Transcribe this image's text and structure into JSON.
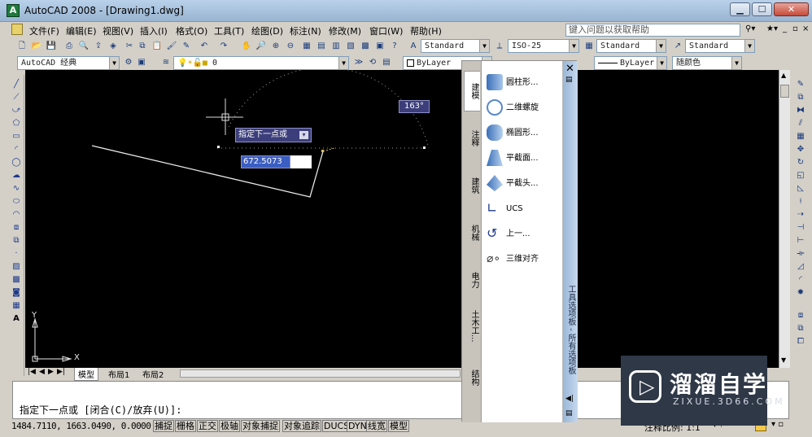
{
  "window": {
    "title": "AutoCAD 2008 - [Drawing1.dwg]",
    "app_icon_label": "A"
  },
  "menubar": {
    "items": [
      "文件(F)",
      "编辑(E)",
      "视图(V)",
      "插入(I)",
      "格式(O)",
      "工具(T)",
      "绘图(D)",
      "标注(N)",
      "修改(M)",
      "窗口(W)",
      "帮助(H)"
    ],
    "help_placeholder": "键入问题以获取帮助"
  },
  "toolbar_styles": {
    "text_style": "Standard",
    "dim_style": "ISO-25",
    "table_style": "Standard",
    "multileader_style": "Standard"
  },
  "toolbar_layers": {
    "workspace": "AutoCAD 经典",
    "layer": "0",
    "color": "ByLayer",
    "linetype": "ByLayer",
    "plotstyle": "随颜色"
  },
  "canvas": {
    "angle_tooltip": "163°",
    "prompt_tooltip": "指定下一点或",
    "length_input": "672.5073",
    "ucs_x": "X",
    "ucs_y": "Y"
  },
  "layout_tabs": [
    "模型",
    "布局1",
    "布局2"
  ],
  "command": {
    "prompt": "指定下一点或 [闭合(C)/放弃(U)]:"
  },
  "statusbar": {
    "coords": "1484.7110, 1663.0490, 0.0000",
    "toggles": [
      "捕捉",
      "栅格",
      "正交",
      "极轴",
      "对象捕捉",
      "对象追踪",
      "DUCS",
      "DYN",
      "线宽",
      "模型"
    ],
    "scale_label": "注释比例: 1:1"
  },
  "palette": {
    "title": "工具选项板 - 所有选项板",
    "tabs": [
      "建模",
      "注释",
      "建筑",
      "机械",
      "电力",
      "土木工...",
      "结构"
    ],
    "items": [
      "圆柱形...",
      "二维螺旋",
      "椭圆形...",
      "平截面...",
      "平截头...",
      "UCS",
      "上一...",
      "三维对齐"
    ]
  },
  "watermark": {
    "brand": "溜溜自学",
    "url": "ZIXUE.3D66.COM"
  }
}
